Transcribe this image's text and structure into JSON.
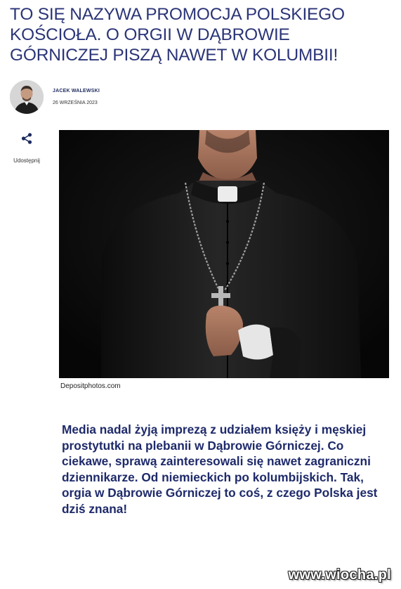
{
  "article": {
    "headline": "TO SIĘ NAZYWA PROMOCJA POLSKIEGO KOŚCIOŁA. O ORGII W DĄBROWIE GÓRNICZEJ PISZĄ NAWET W KOLUMBII!",
    "author": "JACEK WALEWSKI",
    "date": "26 WRZEŚNIA 2023",
    "share_label": "Udostępnij",
    "photo_credit": "Depositphotos.com",
    "lead": "Media nadal żyją imprezą z udziałem księży i męskiej prostytutki na plebanii w Dąbrowie Górniczej. Co ciekawe, sprawą zainteresowali się nawet zagraniczni dziennikarze. Od niemieckich po kolumbijskich. Tak, orgia w Dąbrowie Górniczej to coś, z czego Polska jest dziś znana!"
  },
  "watermark": "www.wiocha.pl",
  "colors": {
    "headline": "#2b3577",
    "lead": "#1e2a6a",
    "photo_background": "#0d0d0d"
  },
  "icons": {
    "share": "share-icon",
    "avatar": "avatar"
  }
}
